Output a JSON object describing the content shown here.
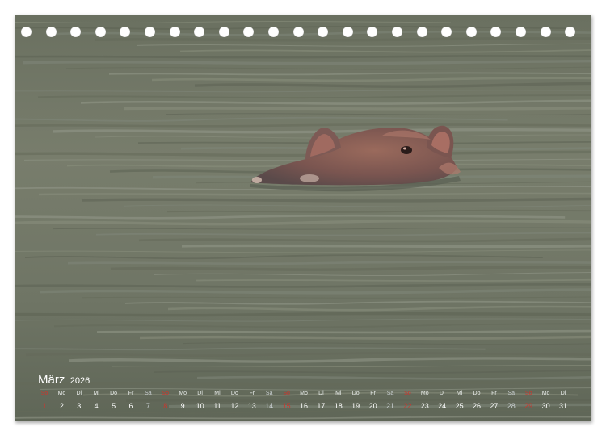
{
  "calendar": {
    "month": "März",
    "year": "2026",
    "weekday_labels": [
      "So",
      "Mo",
      "Di",
      "Mi",
      "Do",
      "Fr",
      "Sa",
      "So",
      "Mo",
      "Di",
      "Mi",
      "Do",
      "Fr",
      "Sa",
      "So",
      "Mo",
      "Di",
      "Mi",
      "Do",
      "Fr",
      "Sa",
      "So",
      "Mo",
      "Di",
      "Mi",
      "Do",
      "Fr",
      "Sa",
      "So",
      "Mo",
      "Di"
    ],
    "days": [
      "1",
      "2",
      "3",
      "4",
      "5",
      "6",
      "7",
      "8",
      "9",
      "10",
      "11",
      "12",
      "13",
      "14",
      "15",
      "16",
      "17",
      "18",
      "19",
      "20",
      "21",
      "22",
      "23",
      "24",
      "25",
      "26",
      "27",
      "28",
      "29",
      "30",
      "31"
    ],
    "sunday_color": "#d0342c",
    "saturday_color": "#c9cfd2"
  },
  "photo": {
    "subject": "hippopotamus-head-in-water",
    "water_color": "#6e7463"
  },
  "binding": {
    "hole_count": 23
  }
}
